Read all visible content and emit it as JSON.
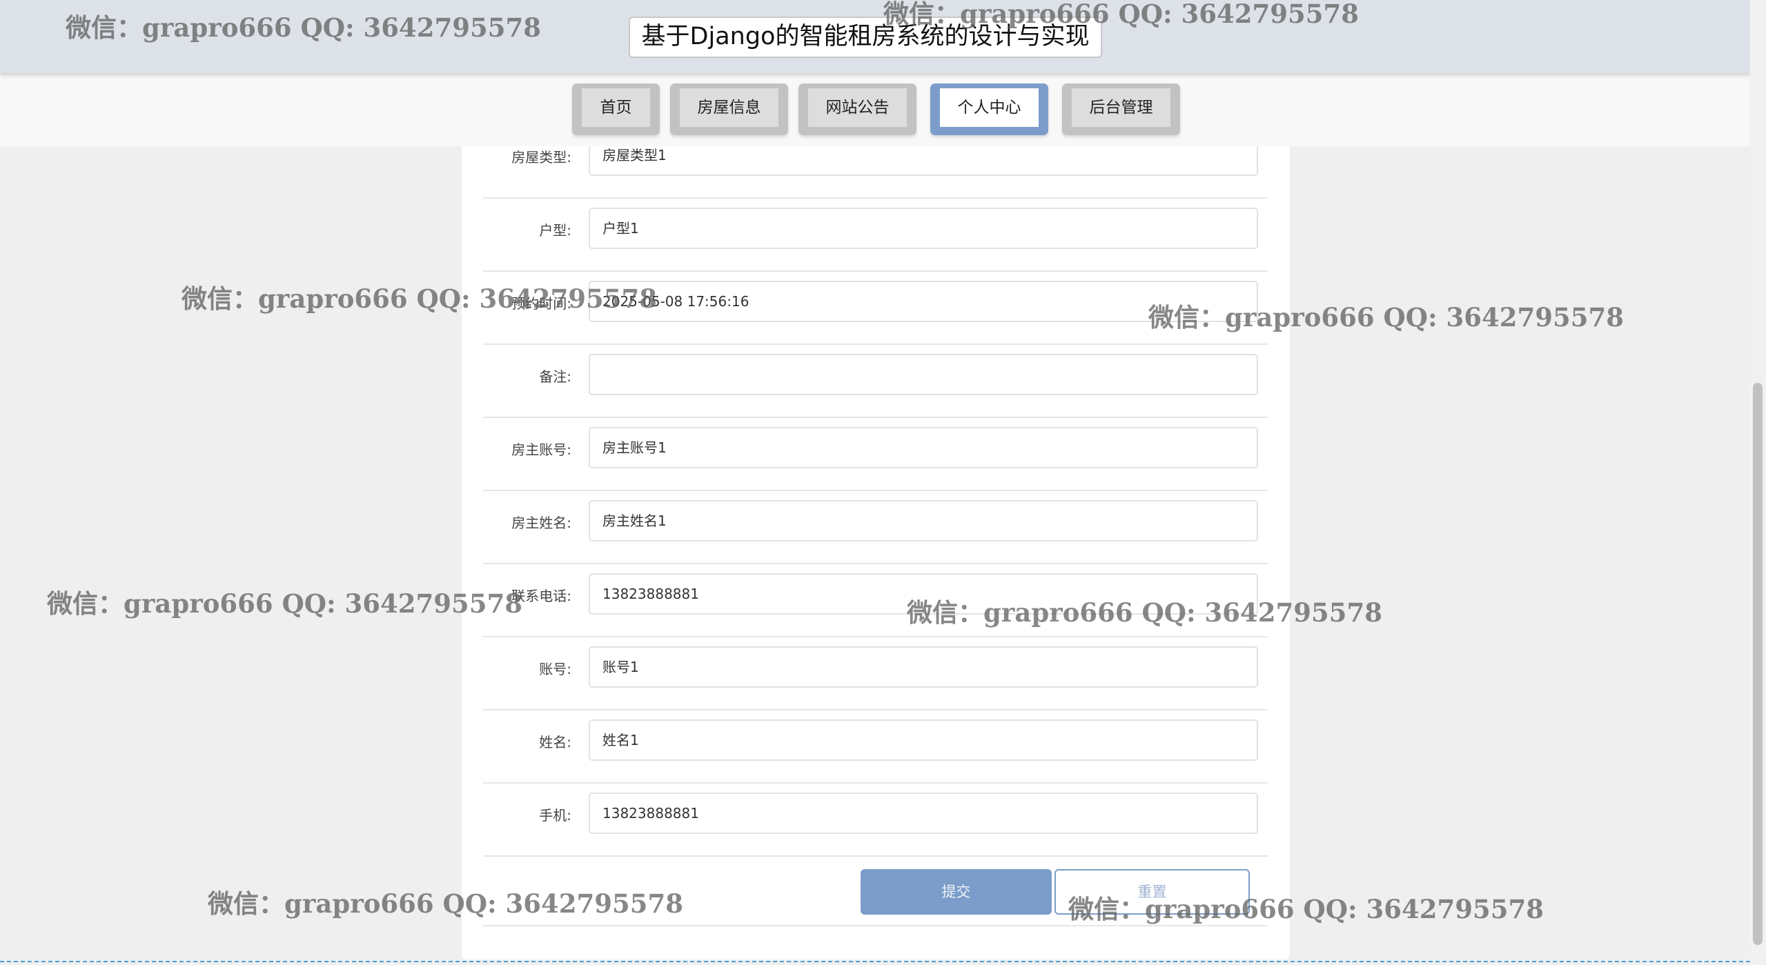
{
  "header": {
    "title": "基于Django的智能租房系统的设计与实现"
  },
  "nav": {
    "items": [
      {
        "label": "首页"
      },
      {
        "label": "房屋信息"
      },
      {
        "label": "网站公告"
      },
      {
        "label": "个人中心",
        "active": true
      },
      {
        "label": "后台管理"
      }
    ]
  },
  "form": {
    "fields": [
      {
        "label": "房屋类型:",
        "value": "房屋类型1"
      },
      {
        "label": "户型:",
        "value": "户型1"
      },
      {
        "label": "预约时间:",
        "value": "2025-05-08 17:56:16"
      },
      {
        "label": "备注:",
        "value": ""
      },
      {
        "label": "房主账号:",
        "value": "房主账号1"
      },
      {
        "label": "房主姓名:",
        "value": "房主姓名1"
      },
      {
        "label": "联系电话:",
        "value": "13823888881"
      },
      {
        "label": "账号:",
        "value": "账号1"
      },
      {
        "label": "姓名:",
        "value": "姓名1"
      },
      {
        "label": "手机:",
        "value": "13823888881"
      }
    ],
    "submit_label": "提交",
    "reset_label": "重置"
  },
  "watermark": {
    "text": "微信：grapro666 QQ: 3642795578"
  },
  "colors": {
    "accent": "#7c9dc9",
    "header_bg": "#dde2e9",
    "page_bg": "#efefef"
  }
}
